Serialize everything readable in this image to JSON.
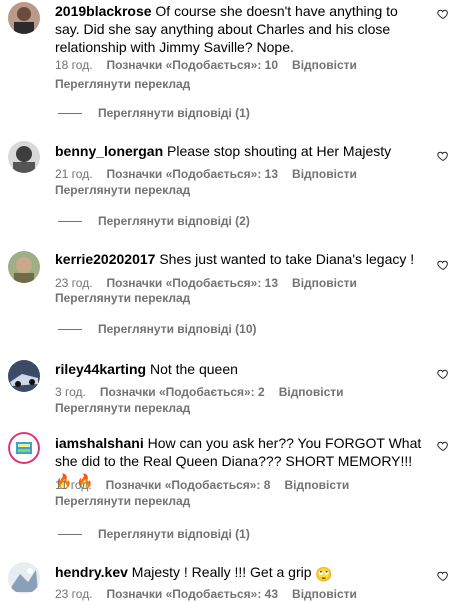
{
  "comments": [
    {
      "username": "2019blackrose",
      "text": "Of course she doesn't have anything to say. Did she say anything about Charles and his close relationship with Jimmy Saville? Nope.",
      "time": "18 год.",
      "likes": "Позначки «Подобається»: 10",
      "reply": "Відповісти",
      "translate": "Переглянути переклад",
      "replies": "Переглянути відповіді (1)"
    },
    {
      "username": "benny_lonergan",
      "text": "Please stop shouting at Her Majesty",
      "time": "21 год.",
      "likes": "Позначки «Подобається»: 13",
      "reply": "Відповісти",
      "translate": "Переглянути переклад",
      "replies": "Переглянути відповіді (2)"
    },
    {
      "username": "kerrie20202017",
      "text": "Shes just wanted to take Diana's legacy !",
      "time": "23 год.",
      "likes": "Позначки «Подобається»: 13",
      "reply": "Відповісти",
      "translate": "Переглянути переклад",
      "replies": "Переглянути відповіді (10)"
    },
    {
      "username": "riley44karting",
      "text": "Not the queen",
      "time": "3 год.",
      "likes": "Позначки «Подобається»: 2",
      "reply": "Відповісти",
      "translate": "Переглянути переклад"
    },
    {
      "username": "iamshalshani",
      "text": "How can you ask her?? You FORGOT What she did to the Real Queen Diana??? SHORT MEMORY!!!",
      "emoji": "🔥 🔥",
      "time": "11 год.",
      "likes": "Позначки «Подобається»: 8",
      "reply": "Відповісти",
      "translate": "Переглянути переклад",
      "replies": "Переглянути відповіді (1)"
    },
    {
      "username": "hendry.kev",
      "text": "Majesty ! Really !!! Get a grip",
      "emoji": "🙄",
      "time": "23 год.",
      "likes": "Позначки «Подобається»: 43",
      "reply": "Відповісти"
    }
  ],
  "colors": {
    "text": "#000000",
    "secondary": "#737373",
    "background": "#ffffff"
  },
  "icons": {
    "like": "heart-outline-icon"
  }
}
